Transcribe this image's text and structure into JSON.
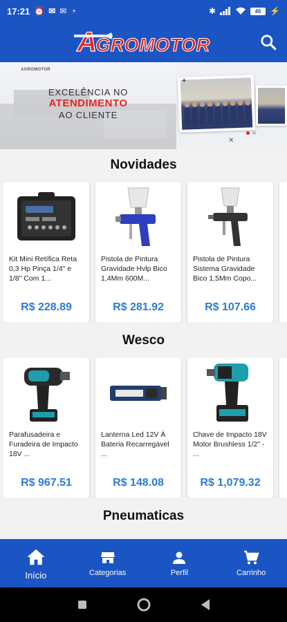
{
  "status_bar": {
    "time": "17:21",
    "battery": "46"
  },
  "header": {
    "logo_initial": "A",
    "logo_rest": "GROMOTOR",
    "brand_color": "#e5251e",
    "bar_color": "#1b55c4"
  },
  "banner": {
    "brand_small": "AGROMOTOR",
    "line1": "EXCELÊNCIA NO",
    "line2": "ATENDIMENTO",
    "line3": "AO CLIENTE"
  },
  "sections": [
    {
      "title": "Novidades",
      "products": [
        {
          "name": "Kit Mini Retífica Reta 0,3 Hp Pinça 1/4\" e 1/8\" Com 1...",
          "price": "R$ 228.89",
          "icon": "tool-case-image"
        },
        {
          "name": "Pistola de Pintura Gravidade Hvlp Bico 1,4Mm 600M...",
          "price": "R$ 281.92",
          "icon": "spray-gun-blue-image"
        },
        {
          "name": "Pistola de Pintura Sistema Gravidade Bico 1,5Mm Copo...",
          "price": "R$ 107.66",
          "icon": "spray-gun-black-image"
        }
      ]
    },
    {
      "title": "Wesco",
      "products": [
        {
          "name": "Parafusadeira e Furadeira de Impacto 18V ...",
          "price": "R$ 967.51",
          "icon": "drill-image"
        },
        {
          "name": "Lanterna Led 12V À Bateria Recarregável ...",
          "price": "R$ 148.08",
          "icon": "flashlight-image"
        },
        {
          "name": "Chave de Impacto 18V Motor Brushless 1/2\" - ...",
          "price": "R$ 1,079.32",
          "icon": "impact-wrench-image"
        }
      ]
    },
    {
      "title": "Pneumaticas"
    }
  ],
  "price_color": "#2b7bd8",
  "bottom_nav": [
    {
      "label": "Início",
      "icon": "home-icon",
      "active": true
    },
    {
      "label": "Categorias",
      "icon": "store-icon"
    },
    {
      "label": "Perfil",
      "icon": "person-icon"
    },
    {
      "label": "Carrinho",
      "icon": "cart-icon"
    }
  ]
}
